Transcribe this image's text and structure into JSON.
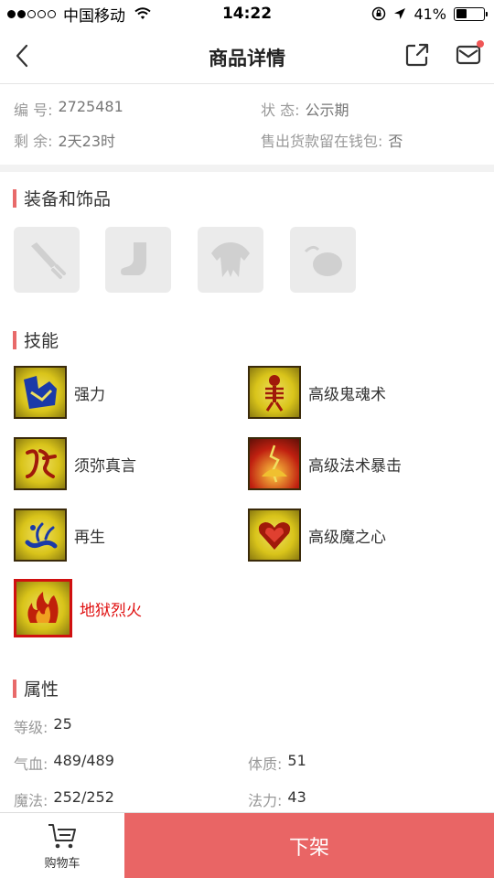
{
  "status_bar": {
    "carrier": "中国移动",
    "time": "14:22",
    "battery": "41%",
    "battery_level": 0.41,
    "signal_dots_filled": 2,
    "signal_dots_total": 5
  },
  "nav": {
    "title": "商品详情"
  },
  "info": {
    "id_label": "编 号:",
    "id_value": "2725481",
    "status_label": "状 态:",
    "status_value": "公示期",
    "remain_label": "剩 余:",
    "remain_value": "2天23时",
    "wallet_label": "售出货款留在钱包:",
    "wallet_value": "否"
  },
  "equipment": {
    "title": "装备和饰品",
    "slots": [
      "weapon-icon",
      "boots-icon",
      "armor-icon",
      "accessory-icon"
    ]
  },
  "skills": {
    "title": "技能",
    "items": [
      {
        "name": "强力",
        "icon": "strength-icon",
        "highlight": false
      },
      {
        "name": "高级鬼魂术",
        "icon": "skeleton-icon",
        "highlight": false
      },
      {
        "name": "须弥真言",
        "icon": "rune-icon",
        "highlight": false
      },
      {
        "name": "高级法术暴击",
        "icon": "crit-icon",
        "highlight": false
      },
      {
        "name": "再生",
        "icon": "regen-icon",
        "highlight": false
      },
      {
        "name": "高级魔之心",
        "icon": "heart-icon",
        "highlight": false
      },
      {
        "name": "地狱烈火",
        "icon": "fire-icon",
        "highlight": true
      }
    ]
  },
  "attributes": {
    "title": "属性",
    "level_label": "等级:",
    "level_value": "25",
    "hp_label": "气血:",
    "hp_value": "489/489",
    "con_label": "体质:",
    "con_value": "51",
    "mp_label": "魔法:",
    "mp_value": "252/252",
    "mag_label": "法力:",
    "mag_value": "43"
  },
  "bottom": {
    "cart_label": "购物车",
    "delist_label": "下架"
  },
  "colors": {
    "accent": "#e96565",
    "section_bar": "#e86a6a",
    "highlight_text": "#e01010"
  }
}
